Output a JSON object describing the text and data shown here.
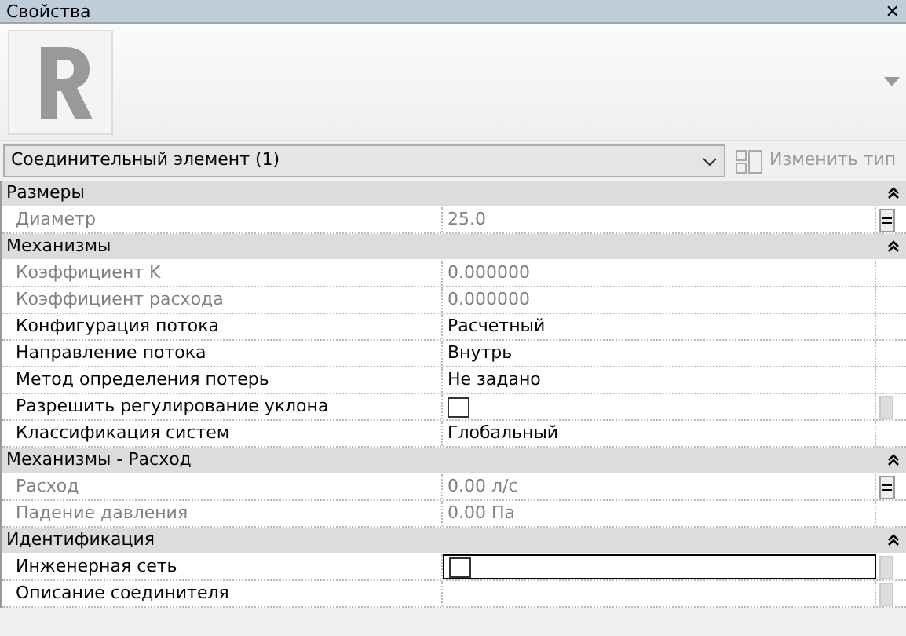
{
  "window": {
    "title": "Свойства",
    "close": "✕"
  },
  "type_selector": {
    "value": "Соединительный элемент (1)",
    "edit_type": "Изменить тип",
    "edit_type_disabled": true
  },
  "groups": [
    {
      "title": "Размеры",
      "expanded": true,
      "rows": [
        {
          "name": "Диаметр",
          "kind": "text",
          "value": "25.0",
          "disabled": true,
          "selected": false,
          "associate_button": true
        }
      ]
    },
    {
      "title": "Механизмы",
      "expanded": true,
      "rows": [
        {
          "name": "Коэффициент K",
          "kind": "text",
          "value": "0.000000",
          "disabled": true,
          "selected": false
        },
        {
          "name": "Коэффициент расхода",
          "kind": "text",
          "value": "0.000000",
          "disabled": true,
          "selected": false
        },
        {
          "name": "Конфигурация потока",
          "kind": "text",
          "value": "Расчетный",
          "disabled": false,
          "selected": false
        },
        {
          "name": "Направление потока",
          "kind": "text",
          "value": "Внутрь",
          "disabled": false,
          "selected": false
        },
        {
          "name": "Метод определения потерь",
          "kind": "text",
          "value": "Не задано",
          "disabled": false,
          "selected": false
        },
        {
          "name": "Разрешить регулирование уклона",
          "kind": "checkbox",
          "checked": false,
          "disabled": false,
          "selected": false,
          "side_button": true
        },
        {
          "name": "Классификация систем",
          "kind": "text",
          "value": "Глобальный",
          "disabled": false,
          "selected": false
        }
      ]
    },
    {
      "title": "Механизмы - Расход",
      "expanded": true,
      "rows": [
        {
          "name": "Расход",
          "kind": "text",
          "value": "0.00 л/с",
          "disabled": true,
          "selected": false,
          "associate_button": true
        },
        {
          "name": "Падение давления",
          "kind": "text",
          "value": "0.00 Па",
          "disabled": true,
          "selected": false
        }
      ]
    },
    {
      "title": "Идентификация",
      "expanded": true,
      "rows": [
        {
          "name": "Инженерная сеть",
          "kind": "checkbox",
          "checked": false,
          "disabled": false,
          "selected": true,
          "side_button": true
        },
        {
          "name": "Описание соединителя",
          "kind": "text",
          "disabled": false,
          "selected": false,
          "side_button": true
        }
      ]
    }
  ]
}
